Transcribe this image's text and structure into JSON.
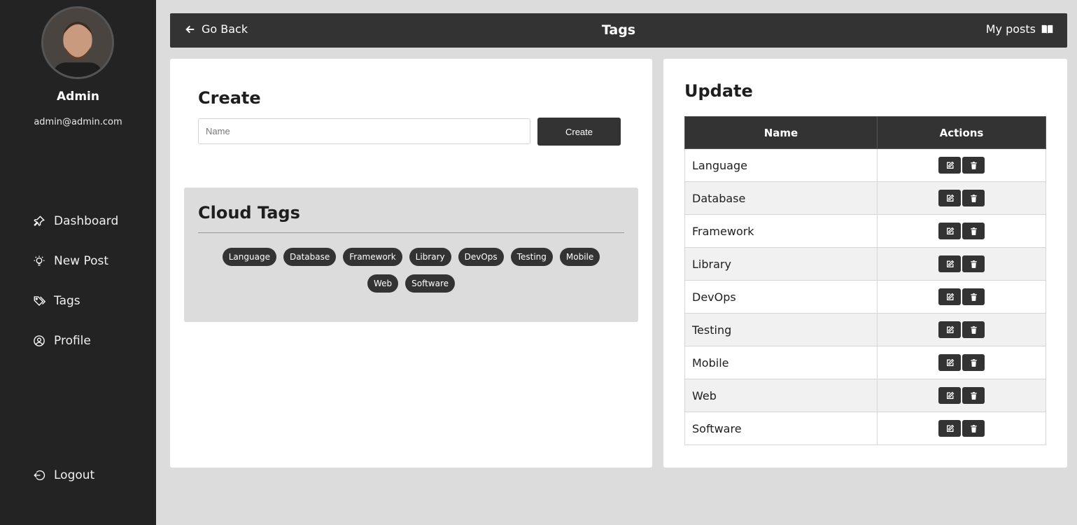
{
  "sidebar": {
    "user_name": "Admin",
    "user_email": "admin@admin.com",
    "nav": [
      {
        "label": "Dashboard",
        "icon": "pin-icon"
      },
      {
        "label": "New Post",
        "icon": "lightbulb-icon"
      },
      {
        "label": "Tags",
        "icon": "tags-icon"
      },
      {
        "label": "Profile",
        "icon": "user-circle-icon"
      }
    ],
    "logout_label": "Logout"
  },
  "header": {
    "back_label": "Go Back",
    "title": "Tags",
    "my_posts_label": "My posts"
  },
  "create": {
    "title": "Create",
    "input_placeholder": "Name",
    "button_label": "Create"
  },
  "cloud": {
    "title": "Cloud Tags",
    "tags": [
      "Language",
      "Database",
      "Framework",
      "Library",
      "DevOps",
      "Testing",
      "Mobile",
      "Web",
      "Software"
    ]
  },
  "update": {
    "title": "Update",
    "columns": [
      "Name",
      "Actions"
    ],
    "rows": [
      "Language",
      "Database",
      "Framework",
      "Library",
      "DevOps",
      "Testing",
      "Mobile",
      "Web",
      "Software"
    ]
  },
  "colors": {
    "sidebar_bg": "#232323",
    "header_bg": "#333333",
    "page_bg": "#dcdcdc",
    "accent": "#333333"
  }
}
